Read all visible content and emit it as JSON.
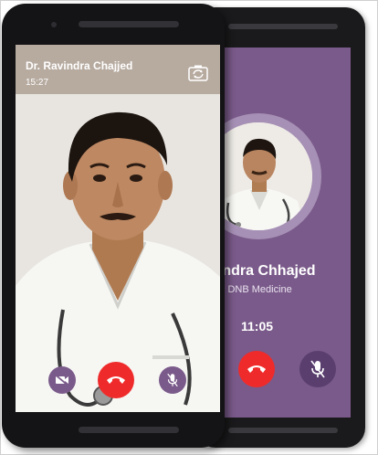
{
  "front_call": {
    "doctor_name": "Dr. Ravindra Chajjed",
    "call_duration": "15:27",
    "header_color": "#b7aba0",
    "controls": {
      "video_toggle_icon": "video-off-icon",
      "end_call_icon": "phone-hangup-icon",
      "mute_icon": "mic-off-icon",
      "switch_camera_icon": "camera-switch-icon"
    }
  },
  "back_call": {
    "doctor_name": "vindra Chhajed",
    "specialization": "S, DNB Medicine",
    "call_timer": "11:05",
    "background_color": "#7a5a8a",
    "controls": {
      "end_call_icon": "phone-hangup-icon",
      "mute_icon": "mic-off-icon"
    }
  },
  "colors": {
    "end_call": "#ef2a2a",
    "control_purple": "#7a5a8a"
  }
}
